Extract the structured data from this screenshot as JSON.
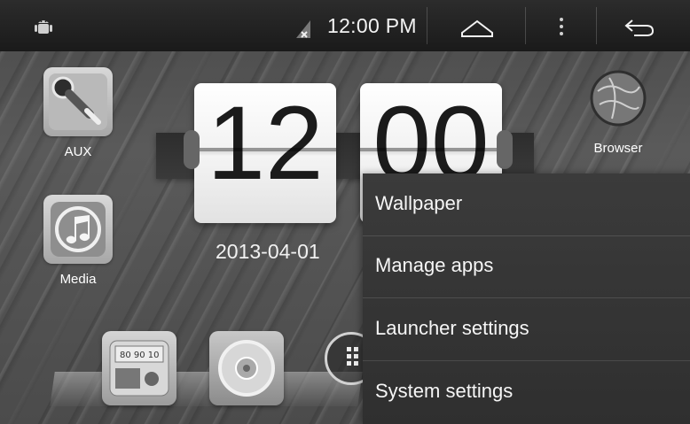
{
  "status_bar": {
    "time": "12:00 PM",
    "icons": [
      "android-icon",
      "no-sim-icon",
      "home-icon",
      "menu-icon",
      "back-icon"
    ]
  },
  "home_apps": {
    "aux": "AUX",
    "media": "Media",
    "browser": "Browser"
  },
  "clock": {
    "hours": "12",
    "minutes": "00",
    "date": "2013-04-01"
  },
  "menu": {
    "items": [
      "Wallpaper",
      "Manage apps",
      "Launcher settings",
      "System settings"
    ]
  },
  "dock": {
    "icons": [
      "radio-icon",
      "disc-icon",
      "apps-icon"
    ]
  },
  "colors": {
    "status_bar": "#1d1d1d",
    "menu_background": "#333333",
    "screen_background": "#535353"
  }
}
